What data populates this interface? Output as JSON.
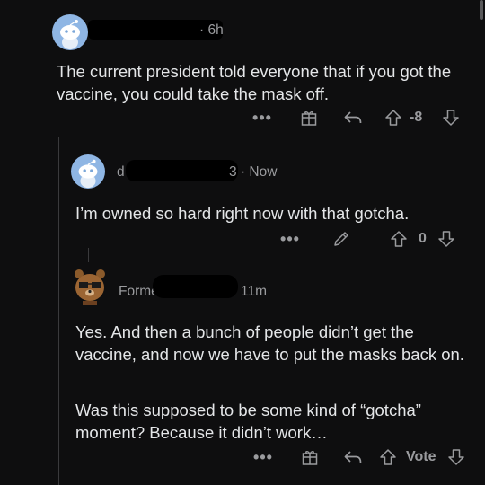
{
  "comments": [
    {
      "username_visible": "",
      "time_visible": "6h",
      "body": "The current president told everyone that if you got the vaccine, you could take the mask off.",
      "score": "-8"
    },
    {
      "username_visible": "d",
      "suffix_visible": "3",
      "time_visible": "Now",
      "body": "I’m owned so hard right now with that gotcha.",
      "score": "0"
    },
    {
      "username_visible": "Former",
      "time_visible": "11m",
      "paragraphs": [
        "Yes. And then a bunch of people didn’t get the vaccine, and now we have to put the masks back on.",
        "Was this supposed to be some kind of “gotcha” moment? Because it didn’t work…"
      ],
      "score": "Vote"
    }
  ],
  "separator": "·",
  "more_label": "•••",
  "icons": {
    "more": "more-options-icon",
    "award": "award-gift-icon",
    "reply": "reply-arrow-icon",
    "edit": "edit-pencil-icon",
    "upvote": "upvote-arrow-icon",
    "downvote": "downvote-arrow-icon"
  },
  "colors": {
    "background": "#0e0e0f",
    "text": "#e4e6e8",
    "muted": "#9a9b9e",
    "avatar_blue": "#8fb6e4"
  }
}
